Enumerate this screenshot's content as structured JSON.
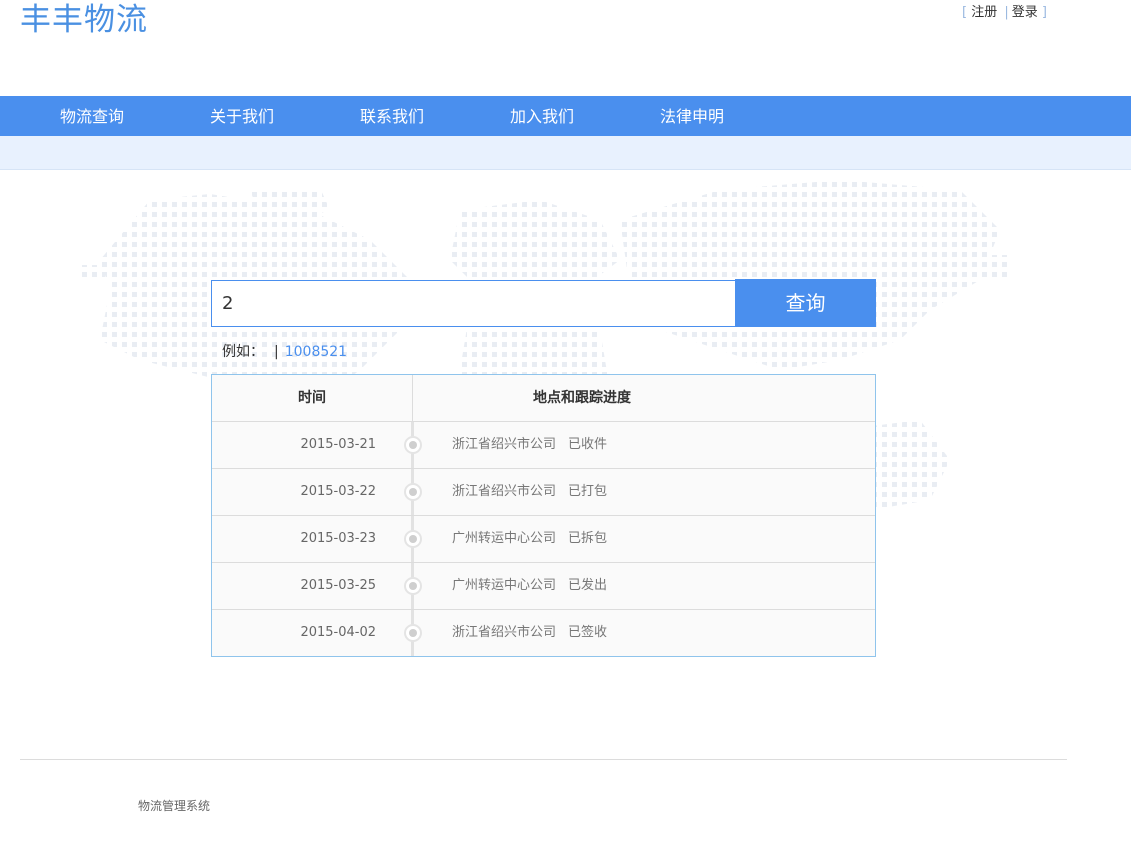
{
  "header": {
    "logo": "丰丰物流",
    "register": "注册",
    "login": "登录"
  },
  "nav": {
    "items": [
      {
        "label": "物流查询"
      },
      {
        "label": "关于我们"
      },
      {
        "label": "联系我们"
      },
      {
        "label": "加入我们"
      },
      {
        "label": "法律申明"
      }
    ]
  },
  "search": {
    "value": "2",
    "button_label": "查询",
    "example_label": "例如：",
    "example_separator": "|",
    "example_value": "1008521"
  },
  "result": {
    "col_time": "时间",
    "col_location": "地点和跟踪进度",
    "rows": [
      {
        "date": "2015-03-21",
        "location": "浙江省绍兴市公司",
        "status": "已收件"
      },
      {
        "date": "2015-03-22",
        "location": "浙江省绍兴市公司",
        "status": "已打包"
      },
      {
        "date": "2015-03-23",
        "location": "广州转运中心公司",
        "status": "已拆包"
      },
      {
        "date": "2015-03-25",
        "location": "广州转运中心公司",
        "status": "已发出"
      },
      {
        "date": "2015-04-02",
        "location": "浙江省绍兴市公司",
        "status": "已签收"
      }
    ]
  },
  "footer": {
    "text": "物流管理系统"
  },
  "colors": {
    "brand_blue": "#4a8fee",
    "subnav_bg": "#e8f1fe"
  }
}
